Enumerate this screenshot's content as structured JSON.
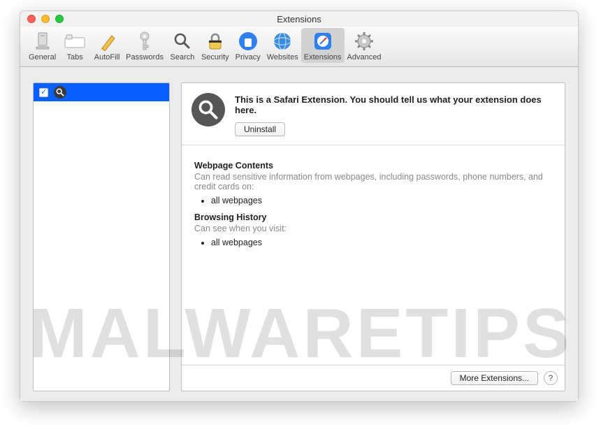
{
  "window": {
    "title": "Extensions"
  },
  "toolbar": {
    "items": [
      {
        "label": "General"
      },
      {
        "label": "Tabs"
      },
      {
        "label": "AutoFill"
      },
      {
        "label": "Passwords"
      },
      {
        "label": "Search"
      },
      {
        "label": "Security"
      },
      {
        "label": "Privacy"
      },
      {
        "label": "Websites"
      },
      {
        "label": "Extensions"
      },
      {
        "label": "Advanced"
      }
    ],
    "selected_index": 8
  },
  "sidebar": {
    "items": [
      {
        "checked": true,
        "icon": "search"
      }
    ]
  },
  "detail": {
    "description": "This is a Safari Extension. You should tell us what your extension does here.",
    "uninstall_label": "Uninstall",
    "sections": [
      {
        "title": "Webpage Contents",
        "subtitle": "Can read sensitive information from webpages, including passwords, phone numbers, and credit cards on:",
        "bullets": [
          "all webpages"
        ]
      },
      {
        "title": "Browsing History",
        "subtitle": "Can see when you visit:",
        "bullets": [
          "all webpages"
        ]
      }
    ]
  },
  "footer": {
    "more_label": "More Extensions...",
    "help_label": "?"
  },
  "watermark": "MALWARETIPS"
}
